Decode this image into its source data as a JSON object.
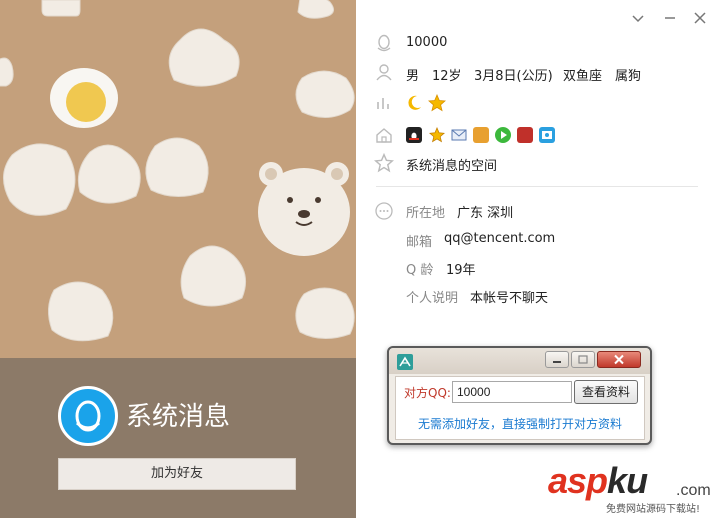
{
  "profile": {
    "nickname": "系统消息",
    "add_friend_label": "加为好友",
    "qq_number": "10000",
    "gender": "男",
    "age": "12岁",
    "birthday": "3月8日(公历)",
    "zodiac": "双鱼座",
    "chinese_zodiac": "属狗",
    "space_label": "系统消息的空间",
    "details": [
      {
        "label": "所在地",
        "value": "广东 深圳"
      },
      {
        "label": "邮箱",
        "value": "qq@tencent.com"
      },
      {
        "label": "Q 龄",
        "value": "19年"
      },
      {
        "label": "个人说明",
        "value": "本帐号不聊天"
      }
    ]
  },
  "icons": {
    "level": [
      "moon-icon",
      "star-icon"
    ],
    "services": [
      "qq-penguin-icon",
      "star-icon",
      "mail-icon",
      "pet-icon",
      "video-icon",
      "game-icon",
      "photo-icon"
    ]
  },
  "window_controls": [
    "chevron-down-icon",
    "minimize-icon",
    "close-icon"
  ],
  "dialog": {
    "peer_label": "对方QQ:",
    "peer_value": "10000",
    "view_button": "查看资料",
    "note": "无需添加好友，直接强制打开对方资料"
  },
  "watermark": {
    "logo_red": "asp",
    "logo_dark": "ku",
    "domain": ".com",
    "subtitle": "免费网站源码下载站!"
  },
  "colors": {
    "wallpaper": "#c4a07c",
    "bottom_bar": "#8c7a68",
    "avatar": "#1aa3ea",
    "dialog_note": "#1a7ad0",
    "dialog_label": "#c0392b"
  }
}
